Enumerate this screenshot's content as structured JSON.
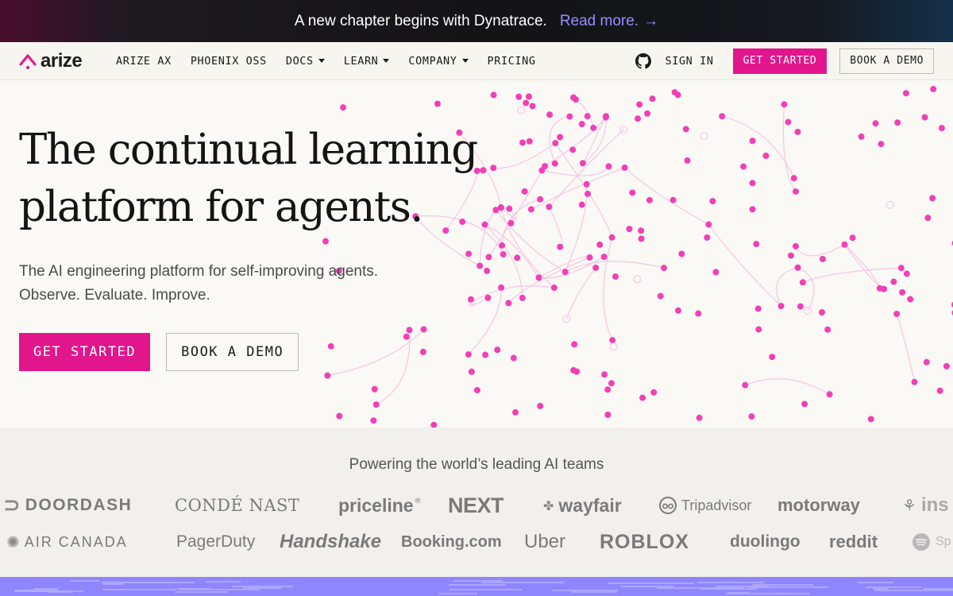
{
  "announcement": {
    "text": "A new chapter begins with Dynatrace.",
    "link_label": "Read more.",
    "arrow": "→"
  },
  "nav": {
    "logo_text": "arize",
    "links": [
      {
        "label": "ARIZE AX",
        "dropdown": false
      },
      {
        "label": "PHOENIX OSS",
        "dropdown": false
      },
      {
        "label": "DOCS",
        "dropdown": true
      },
      {
        "label": "LEARN",
        "dropdown": true
      },
      {
        "label": "COMPANY",
        "dropdown": true
      },
      {
        "label": "PRICING",
        "dropdown": false
      }
    ],
    "github_icon": "github-icon",
    "sign_in": "SIGN IN",
    "get_started": "GET STARTED",
    "book_demo": "BOOK A DEMO"
  },
  "hero": {
    "headline_line1": "The continual learning",
    "headline_line2": "platform for agents.",
    "sub_line1": "The AI engineering platform for self-improving agents.",
    "sub_line2": "Observe. Evaluate. Improve.",
    "cta_primary": "GET STARTED",
    "cta_secondary": "BOOK A DEMO"
  },
  "logos": {
    "title": "Powering the world’s leading AI teams",
    "row1": [
      "DOORDASH",
      "CONDÉ NAST",
      "priceline",
      "NEXT",
      "wayfair",
      "Tripadvisor",
      "motorway",
      "ins"
    ],
    "row2": [
      "AIR CANADA",
      "PagerDuty",
      "Handshake",
      "Booking.com",
      "Uber",
      "ROBLOX",
      "duolingo",
      "reddit",
      "Sp"
    ]
  },
  "colors": {
    "accent": "#e2168c",
    "link": "#9b8cff",
    "stripe": "#8f86ff",
    "node": "#f23fb7"
  }
}
